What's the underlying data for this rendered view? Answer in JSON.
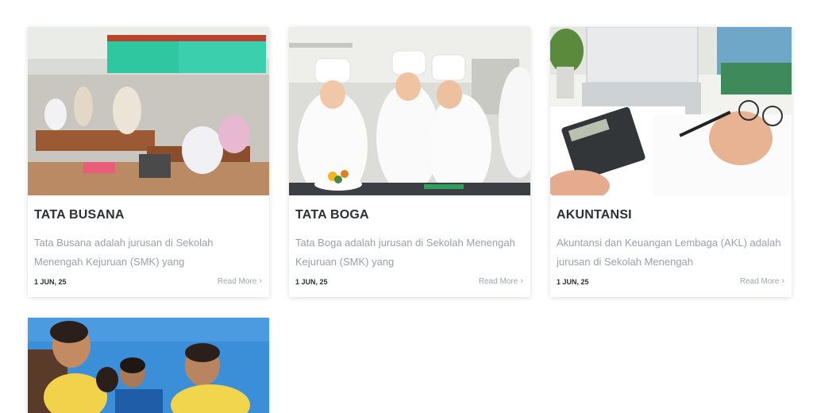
{
  "cards": [
    {
      "title": "TATA BUSANA",
      "excerpt": "Tata Busana adalah jurusan di Sekolah Menengah Kejuruan (SMK) yang",
      "date": "1 JUN, 25",
      "read_more": "Read More",
      "chevron": "›"
    },
    {
      "title": "TATA BOGA",
      "excerpt": "Tata Boga adalah jurusan di Sekolah Menengah Kejuruan (SMK) yang",
      "date": "1 JUN, 25",
      "read_more": "Read More",
      "chevron": "›"
    },
    {
      "title": "AKUNTANSI",
      "excerpt": "Akuntansi dan Keuangan Lembaga (AKL) adalah jurusan di Sekolah Menengah",
      "date": "1 JUN, 25",
      "read_more": "Read More",
      "chevron": "›"
    }
  ],
  "colors": {
    "title": "#2c2f33",
    "excerpt": "#9aa1a8",
    "link": "#a0a7ae"
  }
}
